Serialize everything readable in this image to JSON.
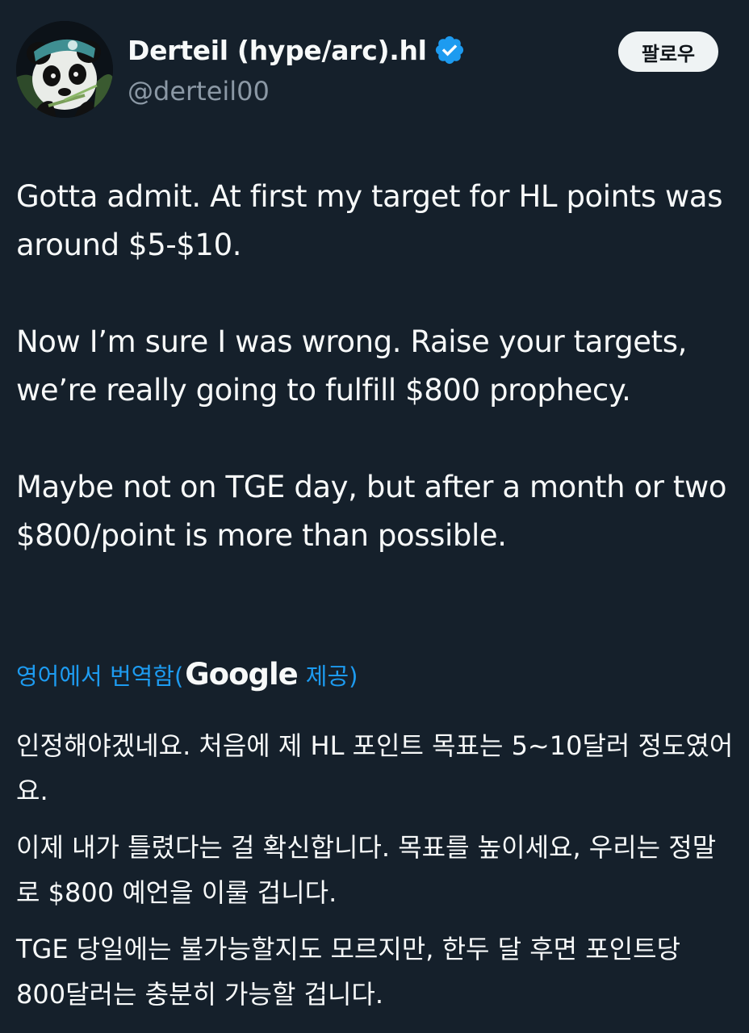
{
  "author": {
    "display_name": "Derteil (hype/arc).hl",
    "handle": "@derteil00",
    "verified": true,
    "avatar_icon": "panda-avatar-icon"
  },
  "follow_button": {
    "label": "팔로우"
  },
  "tweet": {
    "paragraphs": [
      "Gotta admit. At first my target for HL points was around $5-$10.",
      "Now I’m sure I was wrong. Raise your targets, we’re really going to fulfill $800 prophecy.",
      "Maybe not on TGE day, but after a month or two $800/point is more than possible."
    ]
  },
  "translation": {
    "label_prefix": "영어에서 번역함(",
    "provider": "Google",
    "label_suffix": "제공)",
    "paragraphs": [
      "인정해야겠네요. 처음에 제 HL 포인트 목표는 5~10달러 정도였어요.",
      "이제 내가 틀렸다는 걸 확신합니다. 목표를 높이세요, 우리는 정말로 $800 예언을 이룰 겁니다.",
      "TGE 당일에는 불가능할지도 모르지만, 한두 달 후면 포인트당 800달러는 충분히 가능할 겁니다."
    ]
  },
  "colors": {
    "background": "#15202b",
    "text": "#f7f9f9",
    "secondary_text": "#8b98a5",
    "link": "#1d9bf0",
    "verified_badge": "#1d9bf0"
  }
}
